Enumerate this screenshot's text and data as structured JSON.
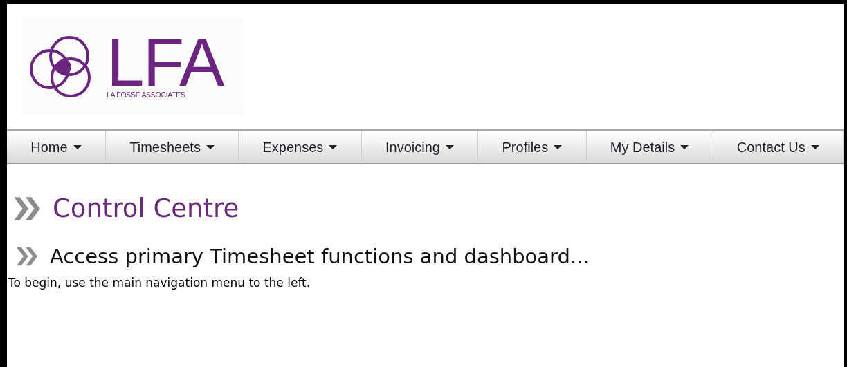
{
  "logo": {
    "initials": "LFA",
    "company": "LA FOSSE ASSOCIATES"
  },
  "menu": [
    {
      "label": "Home"
    },
    {
      "label": "Timesheets"
    },
    {
      "label": "Expenses"
    },
    {
      "label": "Invoicing"
    },
    {
      "label": "Profiles"
    },
    {
      "label": "My Details"
    },
    {
      "label": "Contact Us"
    }
  ],
  "page": {
    "title": "Control Centre",
    "subtitle": "Access primary Timesheet functions and dashboard...",
    "intro": "To begin, use the main navigation menu to the left."
  }
}
